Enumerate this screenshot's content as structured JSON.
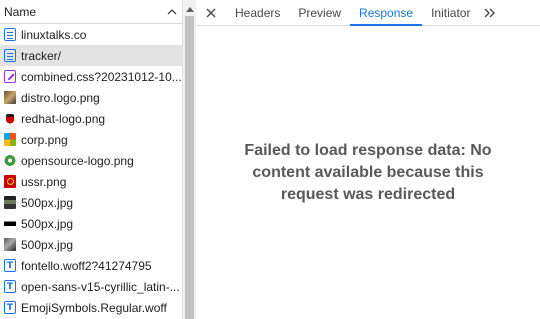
{
  "request_list": {
    "header": {
      "name_label": "Name",
      "sort_icon": "chevron-up-icon"
    },
    "items": [
      {
        "name": "linuxtalks.co",
        "type": "document",
        "icon": "document-icon"
      },
      {
        "name": "tracker/",
        "type": "document",
        "icon": "document-icon",
        "selected": true
      },
      {
        "name": "combined.css?20231012-10...",
        "type": "stylesheet",
        "icon": "stylesheet-icon"
      },
      {
        "name": "distro.logo.png",
        "type": "image",
        "icon": "image-thumbnail"
      },
      {
        "name": "redhat-logo.png",
        "type": "image",
        "icon": "image-thumbnail"
      },
      {
        "name": "corp.png",
        "type": "image",
        "icon": "image-thumbnail"
      },
      {
        "name": "opensource-logo.png",
        "type": "image",
        "icon": "image-thumbnail"
      },
      {
        "name": "ussr.png",
        "type": "image",
        "icon": "image-thumbnail"
      },
      {
        "name": "500px.jpg",
        "type": "image",
        "icon": "image-thumbnail"
      },
      {
        "name": "500px.jpg",
        "type": "image",
        "icon": "image-thumbnail"
      },
      {
        "name": "500px.jpg",
        "type": "image",
        "icon": "image-thumbnail"
      },
      {
        "name": "fontello.woff2?41274795",
        "type": "font",
        "icon": "font-icon"
      },
      {
        "name": "open-sans-v15-cyrillic_latin-...",
        "type": "font",
        "icon": "font-icon"
      },
      {
        "name": "EmojiSymbols.Regular.woff",
        "type": "font",
        "icon": "font-icon"
      }
    ]
  },
  "details": {
    "close_icon": "close-icon",
    "tabs": [
      {
        "label": "Headers",
        "active": false
      },
      {
        "label": "Preview",
        "active": false
      },
      {
        "label": "Response",
        "active": true
      },
      {
        "label": "Initiator",
        "active": false
      }
    ],
    "more_tabs_icon": "double-chevron-right-icon",
    "message": "Failed to load response data: No content available because this request was redirected"
  },
  "colors": {
    "accent": "#1a73e8",
    "selected_row": "#e3e3e3",
    "message_text": "#595959",
    "scrollbar_thumb": "#c1c1c1"
  }
}
